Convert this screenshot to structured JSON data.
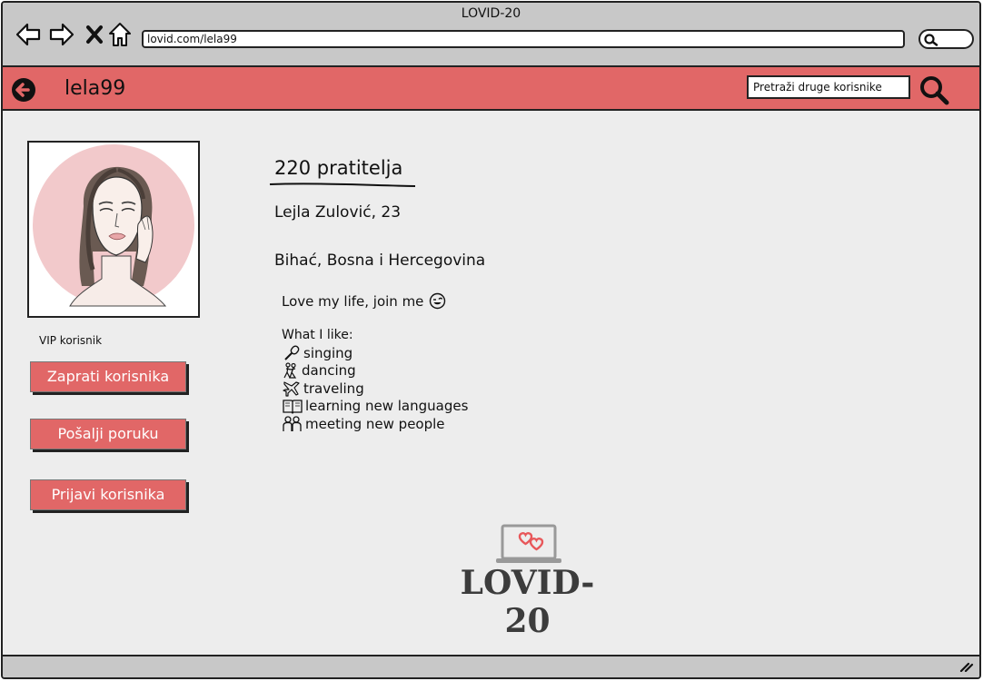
{
  "window": {
    "title": "LOVID-20"
  },
  "browser": {
    "url": "lovid.com/lela99",
    "icons": [
      "back-arrow-icon",
      "forward-arrow-icon",
      "close-x-icon",
      "home-icon",
      "search-icon"
    ]
  },
  "header": {
    "username": "lela99",
    "search_placeholder": "Pretraži druge korisnike",
    "accent_color": "#e16767"
  },
  "profile": {
    "badge": "VIP korisnik",
    "buttons": {
      "follow": "Zaprati korisnika",
      "message": "Pošalji poruku",
      "report": "Prijavi korisnika"
    },
    "followers": "220 pratitelja",
    "full_name": "Lejla Zulović, 23",
    "location": "Bihać, Bosna i Hercegovina",
    "bio": "Love my life, join me",
    "likes_title": "What I like:",
    "likes": [
      {
        "icon": "microphone-icon",
        "label": "singing"
      },
      {
        "icon": "dancing-icon",
        "label": "dancing"
      },
      {
        "icon": "airplane-icon",
        "label": "traveling"
      },
      {
        "icon": "book-icon",
        "label": "learning new languages"
      },
      {
        "icon": "people-icon",
        "label": "meeting new people"
      }
    ]
  },
  "logo": {
    "text": "LOVID-20"
  }
}
